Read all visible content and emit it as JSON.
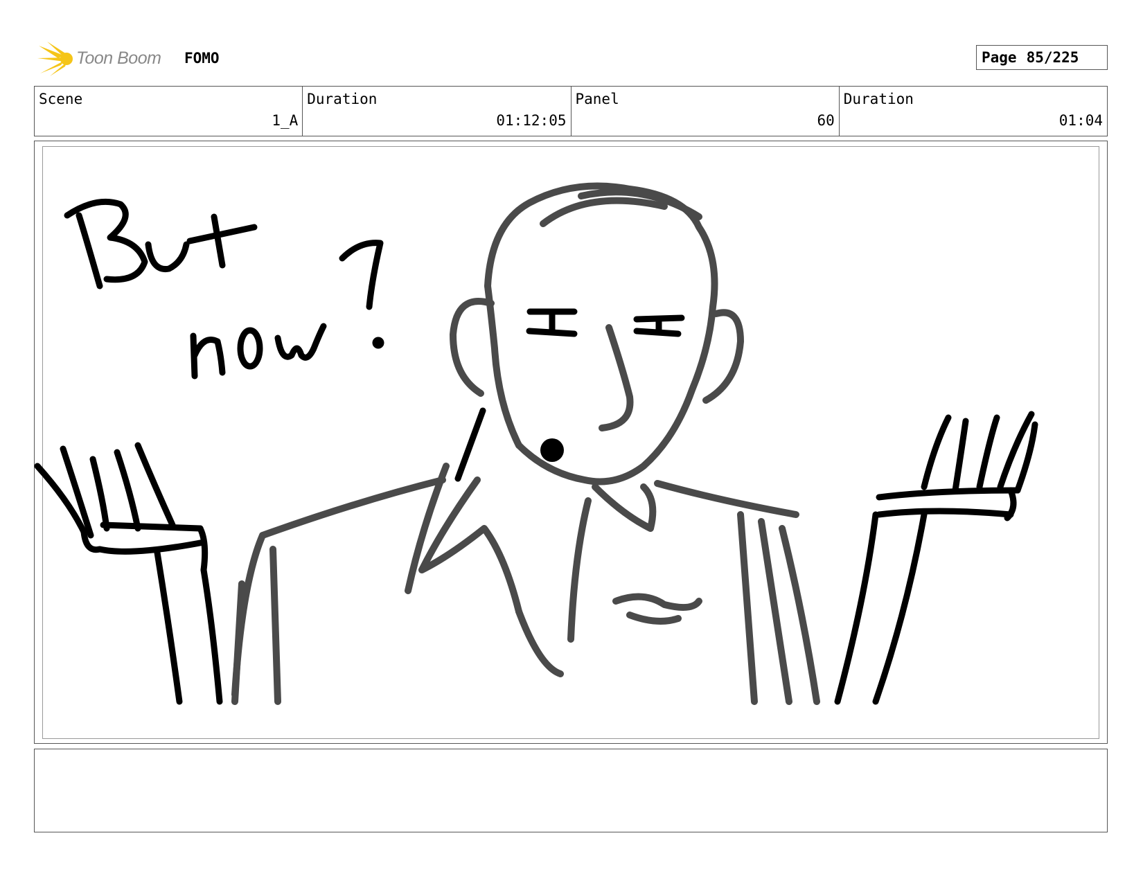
{
  "header": {
    "logo_text": "Toon Boom",
    "project_title": "FOMO",
    "page_label": "Page",
    "page_number": "85/225"
  },
  "info": [
    {
      "label": "Scene",
      "value": "1_A"
    },
    {
      "label": "Duration",
      "value": "01:12:05"
    },
    {
      "label": "Panel",
      "value": "60"
    },
    {
      "label": "Duration",
      "value": "01:04"
    }
  ],
  "panel": {
    "caption": "But now?"
  },
  "notes": {
    "text": ""
  },
  "colors": {
    "ink": "#000000",
    "figure": "#4a4a4a",
    "logo_yellow": "#f5c518",
    "frame": "#555555"
  }
}
